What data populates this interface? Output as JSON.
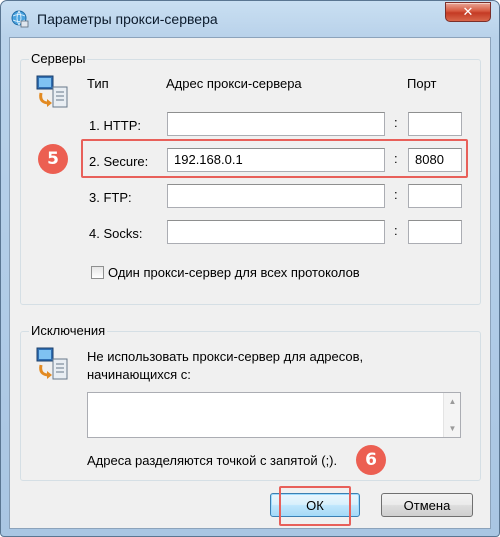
{
  "window": {
    "title": "Параметры прокси-сервера",
    "close_glyph": "✕",
    "icon": "network-globe-icon"
  },
  "servers": {
    "group_title": "Серверы",
    "icon": "network-computers-icon",
    "col_type": "Тип",
    "col_address": "Адрес прокси-сервера",
    "col_port": "Порт",
    "colon": ":",
    "rows": [
      {
        "label": "1. HTTP:",
        "address": "",
        "port": ""
      },
      {
        "label": "2. Secure:",
        "address": "192.168.0.1",
        "port": "8080"
      },
      {
        "label": "3. FTP:",
        "address": "",
        "port": ""
      },
      {
        "label": "4. Socks:",
        "address": "",
        "port": ""
      }
    ],
    "same_proxy_label": "Один прокси-сервер для всех протоколов",
    "same_proxy_checked": false
  },
  "exceptions": {
    "group_title": "Исключения",
    "icon": "network-computers-icon",
    "description": "Не использовать прокси-сервер для адресов, начинающихся с:",
    "value": "",
    "hint": "Адреса разделяются точкой с запятой (;)."
  },
  "buttons": {
    "ok": "ОК",
    "cancel": "Отмена"
  },
  "annotations": {
    "step5": "5",
    "step6": "6",
    "highlight_color": "#e8605a",
    "badge_color": "#ec5f52"
  }
}
